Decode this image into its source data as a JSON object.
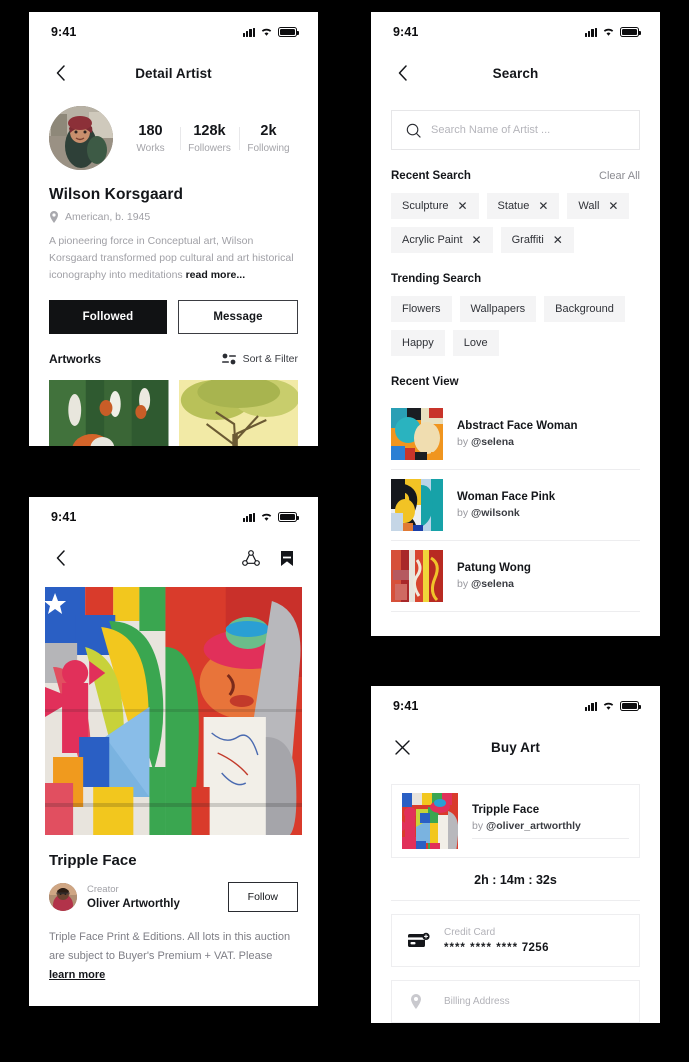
{
  "status_bar": {
    "time": "9:41",
    "signal_icon": "cellular-bars-icon",
    "wifi_icon": "wifi-icon",
    "battery_icon": "battery-full-icon"
  },
  "artist_screen": {
    "nav": {
      "back_icon": "chevron-left-icon",
      "title": "Detail Artist"
    },
    "avatar": "artist-avatar",
    "stats": [
      {
        "value": "180",
        "label": "Works"
      },
      {
        "value": "128k",
        "label": "Followers"
      },
      {
        "value": "2k",
        "label": "Following"
      }
    ],
    "name": "Wilson Korsgaard",
    "location_icon": "location-pin-icon",
    "location": "American, b. 1945",
    "bio": "A pioneering force in Conceptual art, Wilson Korsgaard transformed pop cultural and art historical iconography into meditations ",
    "bio_more": "read more...",
    "followed_label": "Followed",
    "message_label": "Message",
    "artworks_label": "Artworks",
    "sort_filter_label": "Sort & Filter",
    "sort_filter_icon": "sort-filter-icon",
    "artworks": [
      {
        "name": "artwork-thumb-green-figures"
      },
      {
        "name": "artwork-thumb-yellow-tree"
      }
    ]
  },
  "search_screen": {
    "nav": {
      "back_icon": "chevron-left-icon",
      "title": "Search"
    },
    "search": {
      "icon": "search-icon",
      "placeholder": "Search Name of Artist ...",
      "value": ""
    },
    "recent_search_label": "Recent Search",
    "clear_all_label": "Clear All",
    "recent_chips": [
      "Sculpture",
      "Statue",
      "Wall",
      "Acrylic Paint",
      "Graffiti"
    ],
    "chip_remove_icon": "close-x-icon",
    "trending_search_label": "Trending Search",
    "trending_chips": [
      "Flowers",
      "Wallpapers",
      "Background",
      "Happy",
      "Love"
    ],
    "recent_view_label": "Recent View",
    "recent_view": [
      {
        "title": "Abstract Face Woman",
        "by_prefix": "by ",
        "handle": "@selena",
        "thumb": "abstract-face-woman-thumb"
      },
      {
        "title": "Woman Face Pink",
        "by_prefix": "by ",
        "handle": "@wilsonk",
        "thumb": "woman-face-pink-thumb"
      },
      {
        "title": "Patung Wong",
        "by_prefix": "by ",
        "handle": "@selena",
        "thumb": "patung-wong-thumb"
      }
    ]
  },
  "artwork_screen": {
    "nav": {
      "back_icon": "chevron-left-icon",
      "share_icon": "share-icon",
      "bookmark_icon": "bookmark-icon"
    },
    "hero_image": "tripple-face-mural",
    "title": "Tripple Face",
    "creator_avatar": "creator-avatar",
    "creator_label": "Creator",
    "creator_name": "Oliver Artworthly",
    "follow_label": "Follow",
    "description": "Triple Face  Print & Editions. All lots in this auction are subject to Buyer's Premium + VAT. Please ",
    "description_link": "learn more"
  },
  "buy_screen": {
    "nav": {
      "close_icon": "close-x-icon",
      "title": "Buy Art"
    },
    "item": {
      "thumb": "tripple-face-thumb",
      "title": "Tripple Face",
      "by_prefix": "by ",
      "handle": "@oliver_artworthly"
    },
    "countdown": "2h : 14m : 32s",
    "credit_card": {
      "icon": "credit-card-icon",
      "label": "Credit Card",
      "masked": "**** **** ****",
      "last4": "7256"
    },
    "billing": {
      "label": "Billing Address"
    }
  },
  "colors": {
    "page_bg": "#000000",
    "card_bg": "#ffffff",
    "text_primary": "#14161a",
    "text_muted": "#a0a0a6",
    "chip_bg": "#f4f4f5",
    "dark_button": "#111214"
  }
}
